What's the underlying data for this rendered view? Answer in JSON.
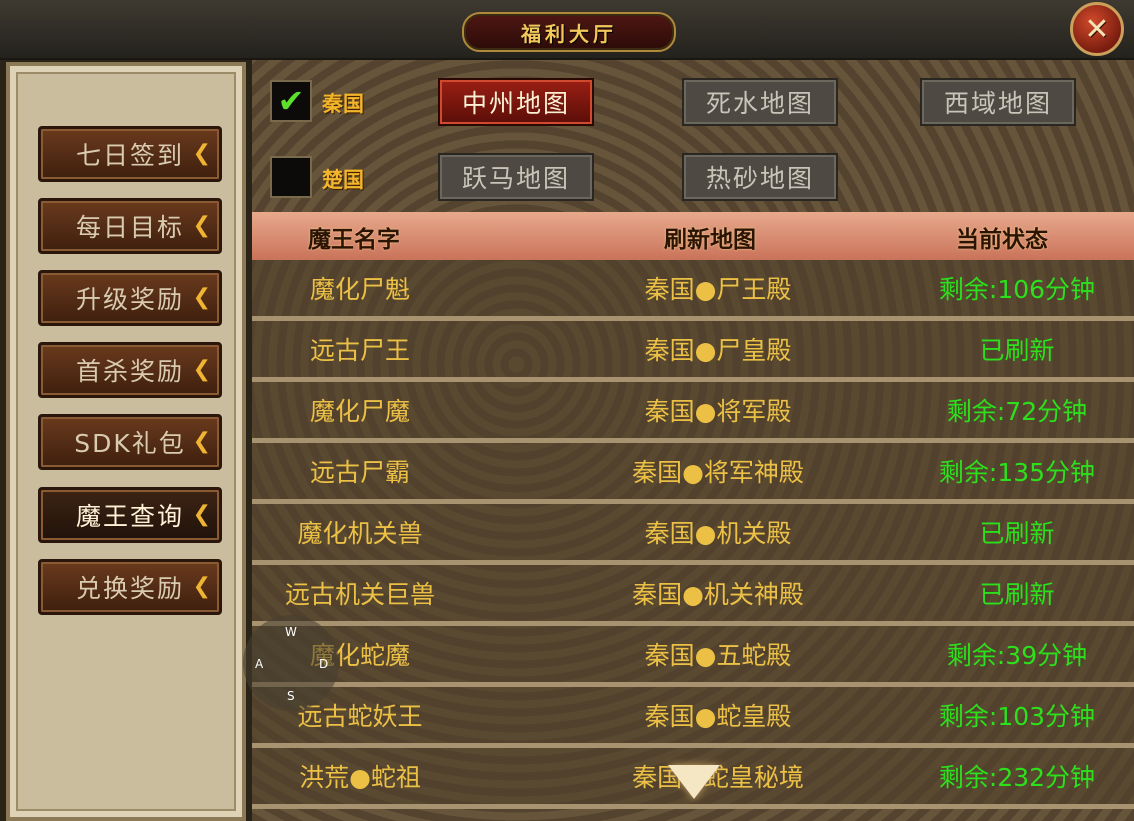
{
  "window": {
    "title": "福利大厅",
    "close_symbol": "✕"
  },
  "sidebar": {
    "items": [
      {
        "label": "七日签到",
        "active": false
      },
      {
        "label": "每日目标",
        "active": false
      },
      {
        "label": "升级奖励",
        "active": false
      },
      {
        "label": "首杀奖励",
        "active": false
      },
      {
        "label": "SDK礼包",
        "active": false
      },
      {
        "label": "魔王查询",
        "active": true
      },
      {
        "label": "兑换奖励",
        "active": false
      }
    ],
    "arrow_symbol": "❮"
  },
  "filters": {
    "qin": {
      "label": "秦国",
      "checked": true,
      "check_symbol": "✔"
    },
    "chu": {
      "label": "楚国",
      "checked": false
    },
    "qin_maps": [
      "中州地图",
      "死水地图",
      "西域地图"
    ],
    "chu_maps": [
      "跃马地图",
      "热砂地图"
    ],
    "selected_map": "中州地图"
  },
  "table": {
    "headers": [
      "魔王名字",
      "刷新地图",
      "当前状态"
    ],
    "rows": [
      {
        "name": "魔化尸魁",
        "map": "秦国●尸王殿",
        "status": "剩余:106分钟"
      },
      {
        "name": "远古尸王",
        "map": "秦国●尸皇殿",
        "status": "已刷新"
      },
      {
        "name": "魔化尸魔",
        "map": "秦国●将军殿",
        "status": "剩余:72分钟"
      },
      {
        "name": "远古尸霸",
        "map": "秦国●将军神殿",
        "status": "剩余:135分钟"
      },
      {
        "name": "魔化机关兽",
        "map": "秦国●机关殿",
        "status": "已刷新"
      },
      {
        "name": "远古机关巨兽",
        "map": "秦国●机关神殿",
        "status": "已刷新"
      },
      {
        "name": "魔化蛇魔",
        "map": "秦国●五蛇殿",
        "status": "剩余:39分钟"
      },
      {
        "name": "远古蛇妖王",
        "map": "秦国●蛇皇殿",
        "status": "剩余:103分钟"
      },
      {
        "name": "洪荒●蛇祖",
        "map": "秦国●蛇皇秘境",
        "status": "剩余:232分钟"
      }
    ]
  },
  "joystick": {
    "up": "W",
    "left": "A",
    "right": "D",
    "down": "S"
  },
  "colors": {
    "accent_gold": "#ebc045",
    "status_green": "#2ce01c",
    "active_red": "#9a1f14"
  }
}
